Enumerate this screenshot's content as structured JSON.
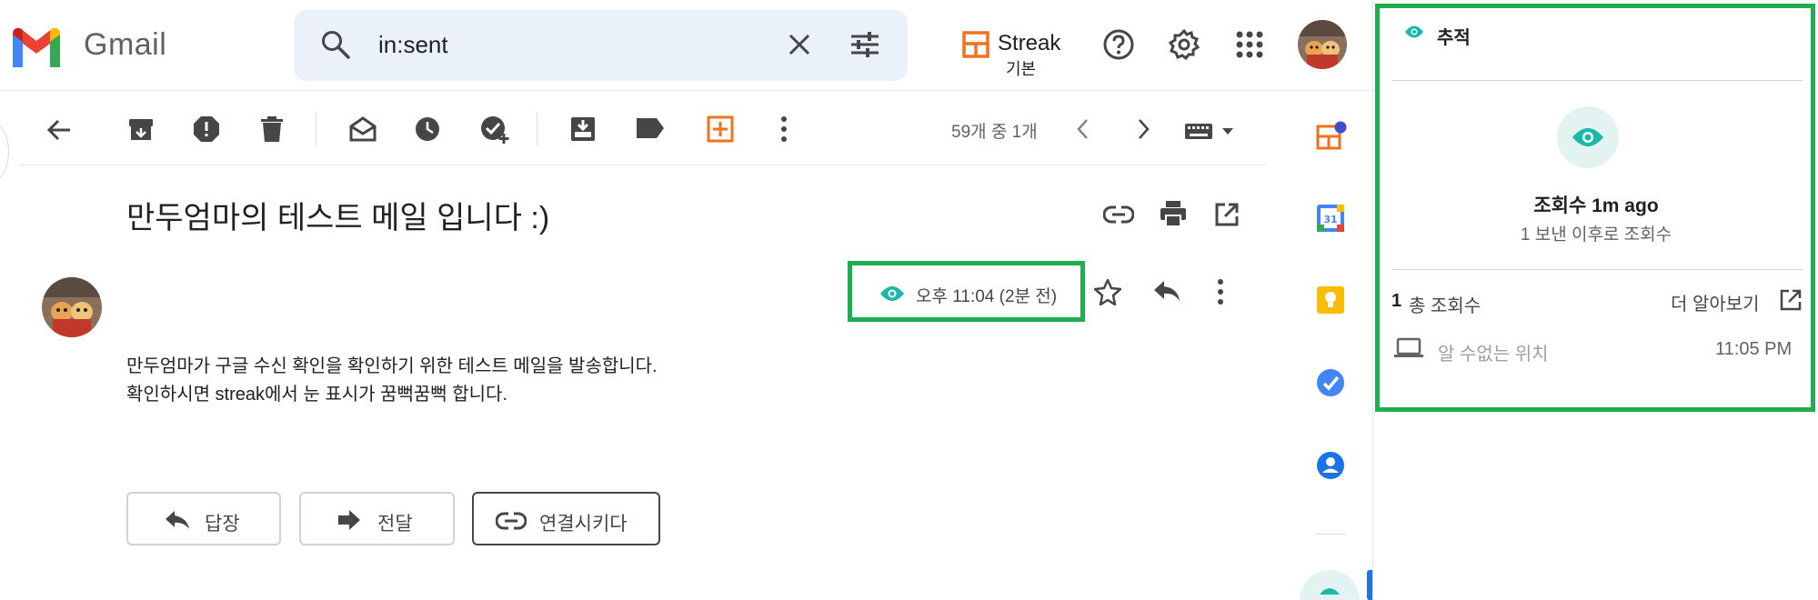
{
  "header": {
    "app_name": "Gmail",
    "search_value": "in:sent",
    "streak_name": "Streak",
    "streak_sub": "기본"
  },
  "toolbar": {
    "pagination": "59개 중 1개"
  },
  "message": {
    "subject": "만두엄마의 테스트 메일 입니다 :)",
    "time": "오후 11:04 (2분 전)",
    "body_lines": [
      "만두엄마가 구글 수신 확인을 확인하기 위한 테스트 메일을 발송합니다.",
      "확인하시면 streak에서 눈 표시가 꿈뻑꿈뻑 합니다."
    ],
    "actions": {
      "reply": "답장",
      "forward": "전달",
      "link": "연결시키다"
    }
  },
  "tracking_panel": {
    "title": "추적",
    "views_title": "조회수 1m ago",
    "views_sub": "1 보낸 이후로 조회수",
    "total_count": "1",
    "total_label": "총 조회수",
    "learn_more": "더 알아보기",
    "location": "알 수없는 위치",
    "view_time": "11:05 PM"
  },
  "colors": {
    "highlight": "#1fad4d",
    "teal": "#1ab8a8",
    "streak_orange": "#f2711c"
  }
}
